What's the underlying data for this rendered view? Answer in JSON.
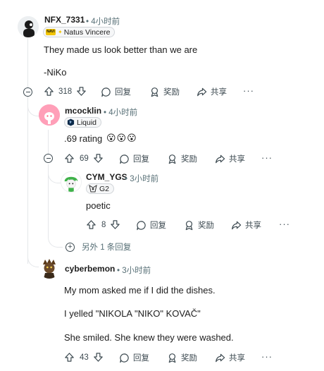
{
  "comments": [
    {
      "username": "NFX_7331",
      "time": "• 4小时前",
      "flair": "Natus Vincere",
      "flair_emblem": "NAVI",
      "body": [
        "They made us look better than we are",
        "-NiKo"
      ],
      "votes": "318",
      "reply": "回复",
      "award": "奖励",
      "share": "共享",
      "more": "···"
    },
    {
      "username": "mcocklin",
      "time": "• 4小时前",
      "flair": "Liquid",
      "body": [
        ".69 rating"
      ],
      "emojis": "😮😮😮",
      "votes": "69",
      "reply": "回复",
      "award": "奖励",
      "share": "共享",
      "more": "···"
    },
    {
      "username": "CYM_YGS",
      "time": "• 3小时前",
      "flair": "G2",
      "body": [
        "poetic"
      ],
      "votes": "8",
      "reply": "回复",
      "award": "奖励",
      "share": "共享",
      "more": "···"
    },
    {
      "username": "cyberbemon",
      "time": "• 3小时前",
      "body": [
        "My mom asked me if I did the dishes.",
        "I yelled \"NIKOLA \"NIKO\" KOVAČ\"",
        "She smiled. She knew they were washed."
      ],
      "votes": "43",
      "reply": "回复",
      "award": "奖励",
      "share": "共享",
      "more": "···"
    }
  ],
  "more_replies": "另外 1 条回复",
  "colors": {
    "meta": "#576f76",
    "action": "#3e4b52",
    "thread": "#e5e7ea"
  }
}
